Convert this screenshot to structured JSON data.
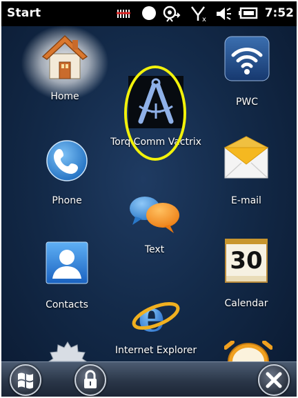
{
  "status": {
    "title": "Start",
    "time": "7:52",
    "icons": [
      "signal-off-icon",
      "circle-icon",
      "connectivity-icon",
      "no-signal-icon",
      "speaker-icon",
      "battery-icon"
    ]
  },
  "apps": [
    {
      "label": "Home",
      "icon": "home-icon"
    },
    {
      "label": "PWC",
      "icon": "wifi-icon"
    },
    {
      "label": "Torq Comm Vactrix",
      "icon": "compass-tool-icon"
    },
    {
      "label": "Phone",
      "icon": "phone-icon"
    },
    {
      "label": "E-mail",
      "icon": "envelope-icon"
    },
    {
      "label": "Text",
      "icon": "chat-bubbles-icon"
    },
    {
      "label": "Contacts",
      "icon": "contact-icon"
    },
    {
      "label": "Calendar",
      "icon": "calendar-icon"
    },
    {
      "label": "Internet Explorer",
      "icon": "internet-explorer-icon"
    },
    {
      "label": "",
      "icon": "settings-gear-icon"
    },
    {
      "label": "",
      "icon": "alarm-clock-icon"
    }
  ],
  "calendar_day": "30",
  "bottom": {
    "buttons": [
      "windows-start-button",
      "lock-button",
      "close-button"
    ]
  },
  "colors": {
    "highlight": "#f2f20a",
    "background": "#132a49"
  }
}
